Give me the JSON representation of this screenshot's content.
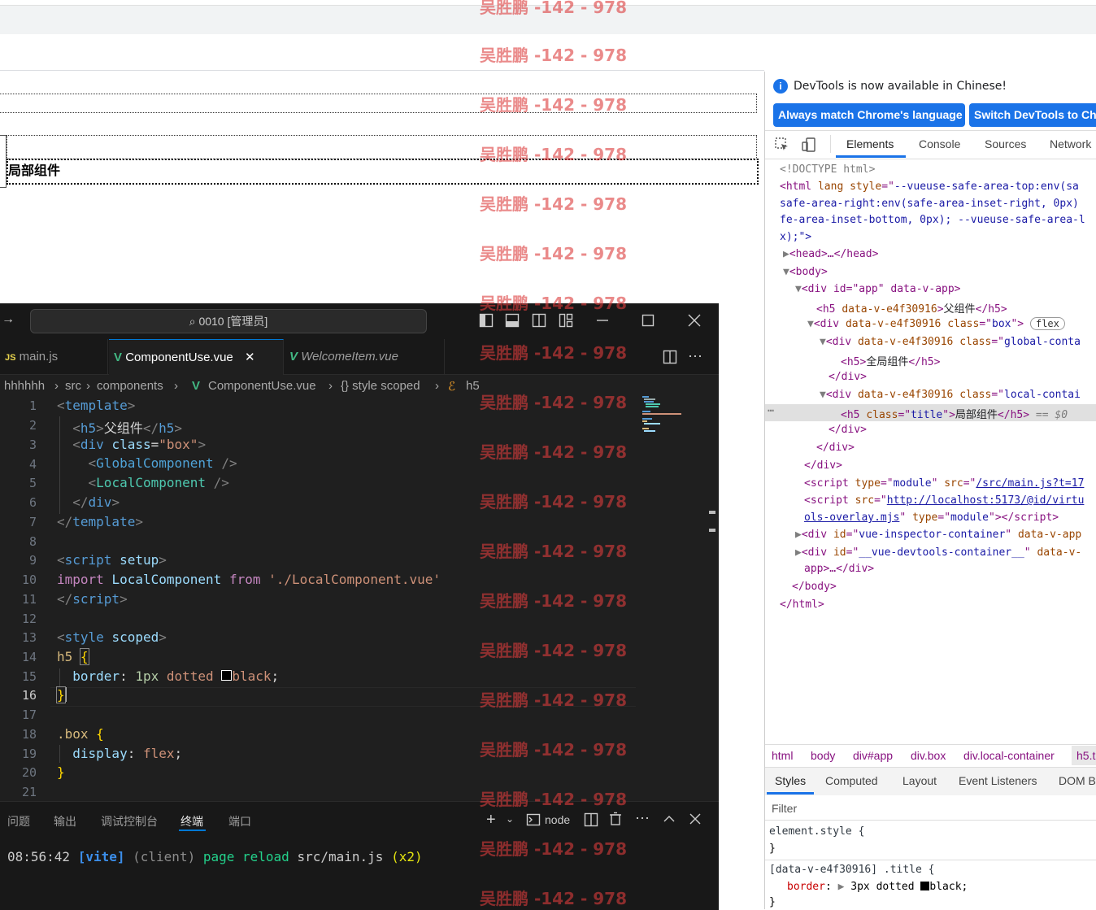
{
  "page": {
    "local_heading": "局部组件"
  },
  "devtools": {
    "info_text": "DevTools is now available in Chinese!",
    "btn_match": "Always match Chrome's language",
    "btn_switch": "Switch DevTools to Chinese",
    "tabs": [
      "Elements",
      "Console",
      "Sources",
      "Network"
    ],
    "dom": {
      "doctype": "<!DOCTYPE html>",
      "html_line1": "--vueuse-safe-area-top:env(sa",
      "html_line2": "safe-area-right:env(safe-area-inset-right, 0px)",
      "html_line3": "fe-area-inset-bottom, 0px); --vueuse-safe-area-l",
      "html_line4": "x);\">",
      "head": "<head>…</head>",
      "body_open": "<body>",
      "div_app": "<div id=\"app\" data-v-app>",
      "h5_parent_text": "父组件",
      "div_box_class": "box",
      "flex_badge": "flex",
      "div_global_class": "global-conta",
      "h5_global_text": "全局组件",
      "div_close": "</div>",
      "div_local_class": "local-contai",
      "h5_local_text": "局部组件",
      "selected_marker": "== $0",
      "script_module_src": "/src/main.js?t=17",
      "script_inspector_src": "http://localhost:5173/@id/virtu",
      "script_inspector_src2": "ols-overlay.mjs",
      "inspector_div": "vue-inspector-container",
      "devtools_div": "__vue-devtools-container__",
      "devtools_div_end": "app>…</div>",
      "body_close": "</body>",
      "html_close": "</html>",
      "data_attr": "data-v-e4f30916"
    },
    "breadcrumbs": [
      "html",
      "body",
      "div#app",
      "div.box",
      "div.local-container",
      "h5.t"
    ],
    "subtabs": [
      "Styles",
      "Computed",
      "Layout",
      "Event Listeners",
      "DOM B"
    ],
    "filter_placeholder": "Filter",
    "styles": {
      "element_style": "element.style {",
      "close_brace": "}",
      "rule_selector": "[data-v-e4f30916] .title {",
      "rule_prop": "border",
      "rule_value_pre": "3px dotted",
      "rule_value_color": "black;"
    }
  },
  "vscode": {
    "search_text": "0010 [管理员]",
    "tabs": [
      {
        "label": "main.js",
        "badge": "JS"
      },
      {
        "label": "ComponentUse.vue",
        "badge": "V"
      },
      {
        "label": "WelcomeItem.vue",
        "badge": "V"
      }
    ],
    "breadcrumbs": [
      "hhhhhh",
      "src",
      "components",
      "ComponentUse.vue",
      "{} style scoped",
      "h5"
    ],
    "line_numbers": [
      "1",
      "2",
      "3",
      "4",
      "5",
      "6",
      "7",
      "8",
      "9",
      "10",
      "11",
      "12",
      "13",
      "14",
      "15",
      "16",
      "17",
      "18",
      "19",
      "20",
      "21"
    ],
    "code": {
      "l1_tag": "template",
      "l2_tag": "h5",
      "l2_text": "父组件",
      "l3_tag": "div",
      "l3_attr": "class",
      "l3_val": "\"box\"",
      "l4_comp": "GlobalComponent",
      "l5_comp": "LocalComponent",
      "l6_tag": "div",
      "l7_tag": "template",
      "l9_tag": "script",
      "l9_attr": "setup",
      "l10_import": "import",
      "l10_name": "LocalComponent",
      "l10_from": "from",
      "l10_path": "'./LocalComponent.vue'",
      "l11_tag": "script",
      "l13_tag": "style",
      "l13_attr": "scoped",
      "l14_sel": "h5",
      "l15_prop": "border",
      "l15_num": "1px",
      "l15_style": "dotted",
      "l15_color": "black",
      "l18_sel": ".box",
      "l19_prop": "display",
      "l19_val": "flex"
    },
    "panel_tabs": [
      "问题",
      "输出",
      "调试控制台",
      "终端",
      "端口"
    ],
    "terminal_shell": "node",
    "terminal": {
      "time": "08:56:42",
      "vite": "[vite]",
      "client": "(client)",
      "msg": "page reload",
      "file": "src/main.js",
      "count": "(x2)"
    }
  },
  "watermark": "吴胜鹏 -142 - 978"
}
